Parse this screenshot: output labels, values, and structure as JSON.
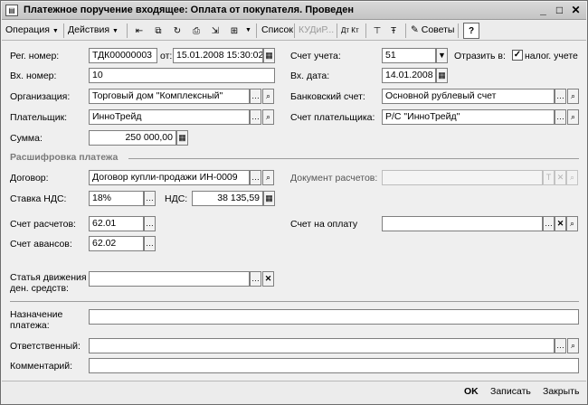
{
  "window": {
    "title": "Платежное поручение входящее: Оплата от покупателя. Проведен"
  },
  "toolbar": {
    "operation_label": "Операция",
    "actions_label": "Действия",
    "list_label": "Список",
    "kudir_label": "КУДиР...",
    "dtkt_label": "Дт Кт",
    "tips_label": "Советы",
    "help_label": "?"
  },
  "form": {
    "reg_number_label": "Рег. номер:",
    "reg_number_value": "ТДК00000003",
    "date_from_label": "от:",
    "date_from_value": "15.01.2008 15:30:02",
    "account_label": "Счет учета:",
    "account_value": "51",
    "reflect_label": "Отразить в:",
    "tax_accounting_label": "налог. учете",
    "tax_accounting_checked": true,
    "incoming_number_label": "Вх. номер:",
    "incoming_number_value": "10",
    "incoming_date_label": "Вх. дата:",
    "incoming_date_value": "14.01.2008",
    "organization_label": "Организация:",
    "organization_value": "Торговый дом \"Комплексный\"",
    "bank_account_label": "Банковский счет:",
    "bank_account_value": "Основной рублевый счет",
    "payer_label": "Плательщик:",
    "payer_value": "ИнноТрейд",
    "payer_account_label": "Счет плательщика:",
    "payer_account_value": "Р/С \"ИнноТрейд\"",
    "amount_label": "Сумма:",
    "amount_value": "250 000,00"
  },
  "breakdown": {
    "section_title": "Расшифровка платежа",
    "contract_label": "Договор:",
    "contract_value": "Договор купли-продажи ИН-0009",
    "settlement_doc_label": "Документ расчетов:",
    "settlement_doc_value": "",
    "vat_rate_label": "Ставка НДС:",
    "vat_rate_value": "18%",
    "vat_label": "НДС:",
    "vat_value": "38 135,59",
    "settlement_account_label": "Счет расчетов:",
    "settlement_account_value": "62.01",
    "invoice_label": "Счет на оплату",
    "invoice_value": "",
    "advance_account_label": "Счет авансов:",
    "advance_account_value": "62.02",
    "cash_flow_label_line1": "Статья движения",
    "cash_flow_label_line2": "ден. средств:",
    "cash_flow_value": ""
  },
  "footer_fields": {
    "purpose_label_line1": "Назначение",
    "purpose_label_line2": "платежа:",
    "purpose_value": "",
    "responsible_label": "Ответственный:",
    "responsible_value": "",
    "comment_label": "Комментарий:",
    "comment_value": ""
  },
  "statusbar": {
    "ok_label": "OK",
    "save_label": "Записать",
    "close_label": "Закрыть"
  },
  "icons": {
    "select": "ellipsis-icon",
    "open": "magnifier-icon",
    "clear": "x-icon",
    "calc": "calculator-icon",
    "dropdown": "triangle-down-icon"
  }
}
